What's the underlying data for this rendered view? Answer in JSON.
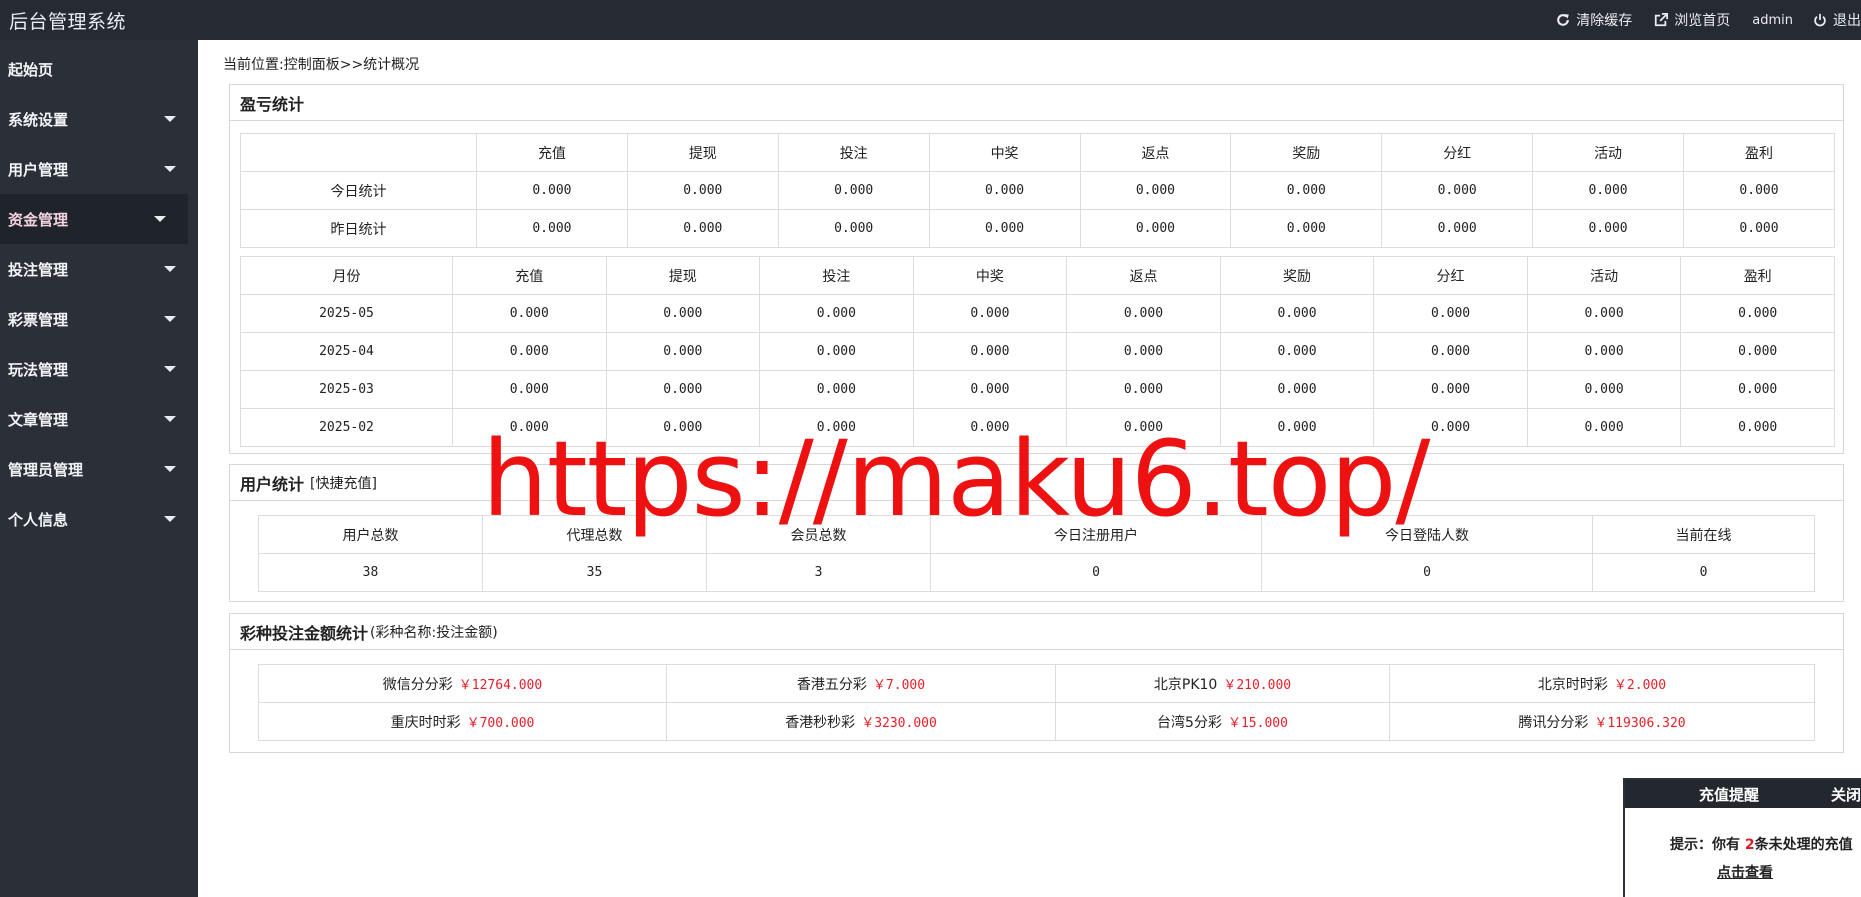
{
  "app": {
    "title": "后台管理系统",
    "clear_cache": "清除缓存",
    "browse_home": "浏览首页",
    "user": "admin",
    "logout": "退出"
  },
  "sidebar": {
    "items": [
      {
        "label": "起始页",
        "has_caret": false
      },
      {
        "label": "系统设置",
        "has_caret": true
      },
      {
        "label": "用户管理",
        "has_caret": true
      },
      {
        "label": "资金管理",
        "has_caret": true,
        "active": true
      },
      {
        "label": "投注管理",
        "has_caret": true
      },
      {
        "label": "彩票管理",
        "has_caret": true
      },
      {
        "label": "玩法管理",
        "has_caret": true
      },
      {
        "label": "文章管理",
        "has_caret": true
      },
      {
        "label": "管理员管理",
        "has_caret": true
      },
      {
        "label": "个人信息",
        "has_caret": true
      }
    ]
  },
  "breadcrumb": "当前位置:控制面板>>统计概况",
  "profit": {
    "title": "盈亏统计",
    "columns": [
      "充值",
      "提现",
      "投注",
      "中奖",
      "返点",
      "奖励",
      "分红",
      "活动",
      "盈利"
    ],
    "daily_rows": [
      {
        "label": "今日统计",
        "values": [
          "0.000",
          "0.000",
          "0.000",
          "0.000",
          "0.000",
          "0.000",
          "0.000",
          "0.000",
          "0.000"
        ]
      },
      {
        "label": "昨日统计",
        "values": [
          "0.000",
          "0.000",
          "0.000",
          "0.000",
          "0.000",
          "0.000",
          "0.000",
          "0.000",
          "0.000"
        ]
      }
    ],
    "month_header": "月份",
    "monthly_rows": [
      {
        "label": "2025-05",
        "values": [
          "0.000",
          "0.000",
          "0.000",
          "0.000",
          "0.000",
          "0.000",
          "0.000",
          "0.000",
          "0.000"
        ]
      },
      {
        "label": "2025-04",
        "values": [
          "0.000",
          "0.000",
          "0.000",
          "0.000",
          "0.000",
          "0.000",
          "0.000",
          "0.000",
          "0.000"
        ]
      },
      {
        "label": "2025-03",
        "values": [
          "0.000",
          "0.000",
          "0.000",
          "0.000",
          "0.000",
          "0.000",
          "0.000",
          "0.000",
          "0.000"
        ]
      },
      {
        "label": "2025-02",
        "values": [
          "0.000",
          "0.000",
          "0.000",
          "0.000",
          "0.000",
          "0.000",
          "0.000",
          "0.000",
          "0.000"
        ]
      }
    ]
  },
  "users": {
    "title": "用户统计",
    "quick_recharge": "[快捷充值]",
    "headers": [
      "用户总数",
      "代理总数",
      "会员总数",
      "今日注册用户",
      "今日登陆人数",
      "当前在线"
    ],
    "values": [
      "38",
      "35",
      "3",
      "0",
      "0",
      "0"
    ]
  },
  "lottery": {
    "title": "彩种投注金额统计",
    "subtitle": "(彩种名称:投注金额)",
    "rows": [
      [
        {
          "name": "微信分分彩",
          "amount": "￥12764.000"
        },
        {
          "name": "香港五分彩",
          "amount": "￥7.000"
        },
        {
          "name": "北京PK10",
          "amount": "￥210.000"
        },
        {
          "name": "北京时时彩",
          "amount": "￥2.000"
        }
      ],
      [
        {
          "name": "重庆时时彩",
          "amount": "￥700.000"
        },
        {
          "name": "香港秒秒彩",
          "amount": "￥3230.000"
        },
        {
          "name": "台湾5分彩",
          "amount": "￥15.000"
        },
        {
          "name": "腾讯分分彩",
          "amount": "￥119306.320"
        }
      ]
    ]
  },
  "watermark": "https://maku6.top/",
  "popup": {
    "title": "充值提醒",
    "close": "关闭",
    "prefix": "提示：你有",
    "count": "2",
    "suffix": "条未处理的充值",
    "link": "点击查看"
  },
  "colors": {
    "topbar": "#262b33",
    "sidebar": "#2a2f38",
    "active_item": "#1f232a",
    "amount": "#e8202a"
  }
}
